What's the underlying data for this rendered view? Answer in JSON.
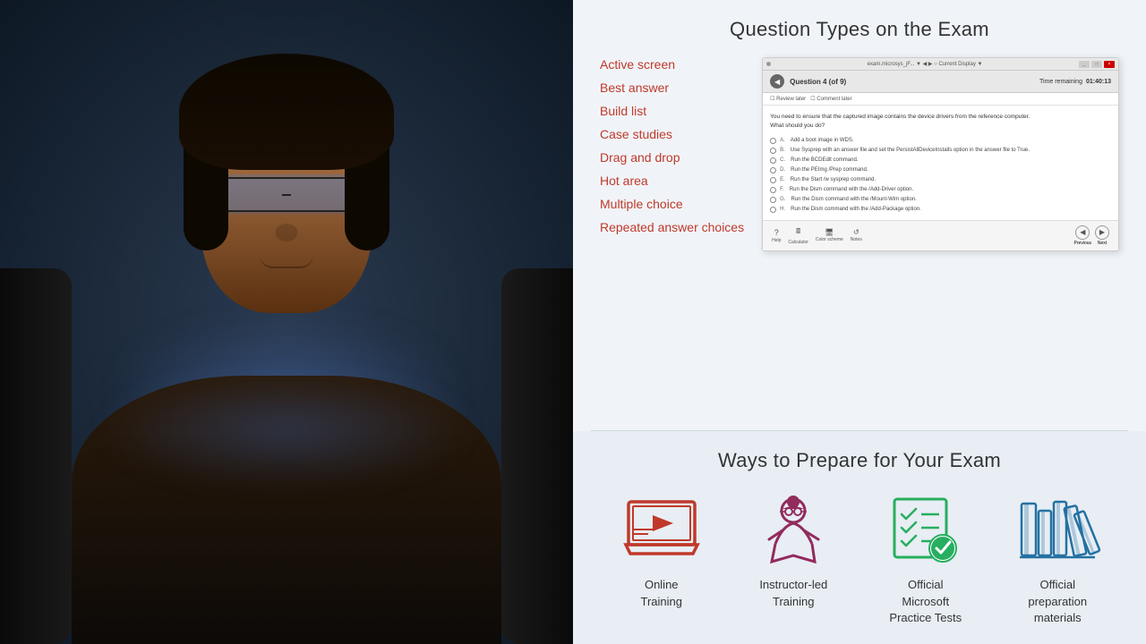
{
  "left_panel": {
    "description": "Man looking at screen in dark car interior"
  },
  "right_panel": {
    "question_types": {
      "title": "Question Types on the Exam",
      "items": [
        {
          "label": "Active screen",
          "id": "active-screen"
        },
        {
          "label": "Best answer",
          "id": "best-answer"
        },
        {
          "label": "Build list",
          "id": "build-list"
        },
        {
          "label": "Case studies",
          "id": "case-studies"
        },
        {
          "label": "Drag and drop",
          "id": "drag-and-drop"
        },
        {
          "label": "Hot area",
          "id": "hot-area"
        },
        {
          "label": "Multiple choice",
          "id": "multiple-choice"
        },
        {
          "label": "Repeated answer choices",
          "id": "repeated-answer-choices"
        }
      ],
      "exam_mockup": {
        "titlebar": "exam.microsys_jF...",
        "question_number": "Question 4 (of 9)",
        "time_label": "Time remaining",
        "time_value": "01:40:13",
        "checkbox1": "Review later",
        "checkbox2": "Comment later",
        "question_text": "You need to ensure that the captured image contains the device drivers from the reference computer. What should you do?",
        "options": [
          {
            "label": "A.",
            "text": "Add a boot image in WDS."
          },
          {
            "label": "B.",
            "text": "Use Sysprep with an answer file and set the PersistAllDeviceInstalls option in the answer file to True."
          },
          {
            "label": "C.",
            "text": "Run the BCDEdit command."
          },
          {
            "label": "D.",
            "text": "Run the PEImg /Prep command."
          },
          {
            "label": "E.",
            "text": "Run the Start /w sysprep command."
          },
          {
            "label": "F.",
            "text": "Run the Dism command with the /Add-Driver option."
          },
          {
            "label": "G.",
            "text": "Run the Dism command with the /Mount-Wim option."
          },
          {
            "label": "H.",
            "text": "Run the Dism command with the /Add-Package option."
          }
        ],
        "footer_icons": [
          "Help",
          "Calculator",
          "Color scheme",
          "Notes"
        ],
        "nav_labels": [
          "Previous",
          "Next"
        ]
      }
    },
    "ways_to_prepare": {
      "title": "Ways to Prepare for Your Exam",
      "items": [
        {
          "label": "Online\nTraining",
          "icon": "laptop-video-icon",
          "color": "#c0392b"
        },
        {
          "label": "Instructor-led\nTraining",
          "icon": "instructor-icon",
          "color": "#922b5e"
        },
        {
          "label": "Official\nMicrosoft\nPractice Tests",
          "icon": "checklist-icon",
          "color": "#27ae60"
        },
        {
          "label": "Official\npreparation\nmaterials",
          "icon": "books-icon",
          "color": "#2471a3"
        }
      ]
    }
  }
}
